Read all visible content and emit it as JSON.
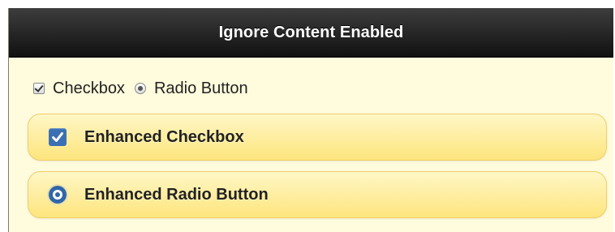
{
  "header": {
    "title": "Ignore Content Enabled"
  },
  "plain_controls": {
    "checkbox_label": "Checkbox",
    "checkbox_checked": true,
    "radio_label": "Radio Button",
    "radio_selected": true
  },
  "enhanced_controls": {
    "checkbox_label": "Enhanced Checkbox",
    "checkbox_checked": true,
    "radio_label": "Enhanced Radio Button",
    "radio_selected": true
  },
  "icons": {
    "plain_checkbox": "checkbox-checked-icon",
    "plain_radio": "radio-selected-icon",
    "enhanced_checkbox": "checkmark-icon",
    "enhanced_radio": "radio-dot-icon"
  },
  "colors": {
    "header_bg": "#1a1a1a",
    "content_bg": "#fffbdd",
    "button_gradient_top": "#fff7c6",
    "button_gradient_bottom": "#fde57d",
    "button_border": "#f0cd6a",
    "accent_blue": "#3b6fb3"
  }
}
